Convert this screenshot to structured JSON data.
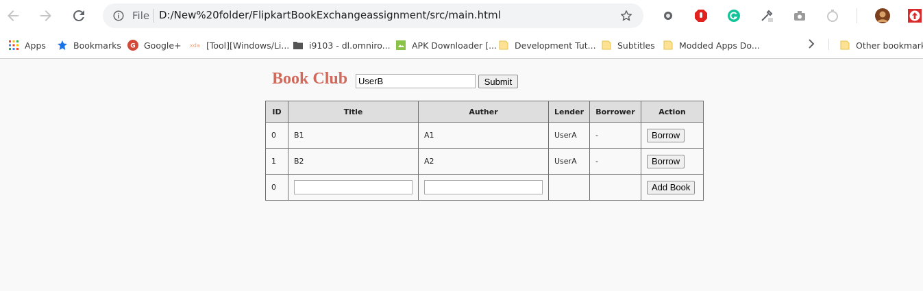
{
  "browser": {
    "omnibox": {
      "scheme_label": "File",
      "url": "D:/New%20folder/FlipkartBookExchangeassignment/src/main.html"
    },
    "bookmarks": [
      {
        "label": "Apps",
        "icon": "apps-grid-icon"
      },
      {
        "label": "Bookmarks",
        "icon": "star-icon"
      },
      {
        "label": "Google+",
        "icon": "google-plus-icon"
      },
      {
        "label": "[Tool][Windows/Li...",
        "icon": "xda-icon"
      },
      {
        "label": "i9103 - dl.omniro...",
        "icon": "folder-icon"
      },
      {
        "label": "APK Downloader [...",
        "icon": "android-icon"
      },
      {
        "label": "Development Tut...",
        "icon": "folder-icon"
      },
      {
        "label": "Subtitles",
        "icon": "folder-icon"
      },
      {
        "label": "Modded Apps Do...",
        "icon": "folder-icon"
      }
    ],
    "other_bookmarks": "Other bookmarks"
  },
  "page": {
    "title": "Book Club",
    "user_input_value": "UserB",
    "submit_label": "Submit",
    "table": {
      "headers": [
        "ID",
        "Title",
        "Auther",
        "Lender",
        "Borrower",
        "Action"
      ],
      "rows": [
        {
          "id": "0",
          "title": "B1",
          "auther": "A1",
          "lender": "UserA",
          "borrower": "-",
          "action": "Borrow"
        },
        {
          "id": "1",
          "title": "B2",
          "auther": "A2",
          "lender": "UserA",
          "borrower": "-",
          "action": "Borrow"
        }
      ],
      "new_row": {
        "id": "0",
        "title_value": "",
        "auther_value": "",
        "action": "Add Book"
      }
    }
  },
  "colors": {
    "title": "#d06a5c",
    "page_background": "#f9f9f9",
    "header_background": "#dedede"
  }
}
